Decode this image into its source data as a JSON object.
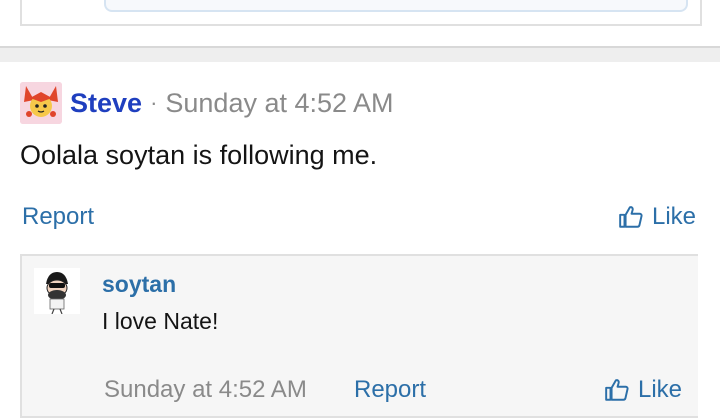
{
  "post": {
    "author": "Steve",
    "separator": "·",
    "timestamp": "Sunday at 4:52 AM",
    "text": "Oolala soytan is following me.",
    "report_label": "Report",
    "like_label": "Like",
    "icons": {
      "like": "thumbs-up-icon"
    }
  },
  "reply": {
    "author": "soytan",
    "text": "I love Nate!",
    "timestamp": "Sunday at 4:52 AM",
    "report_label": "Report",
    "like_label": "Like"
  },
  "colors": {
    "username": "#1f3fbf",
    "link": "#2c6fa8",
    "muted": "#8a8a8a"
  }
}
